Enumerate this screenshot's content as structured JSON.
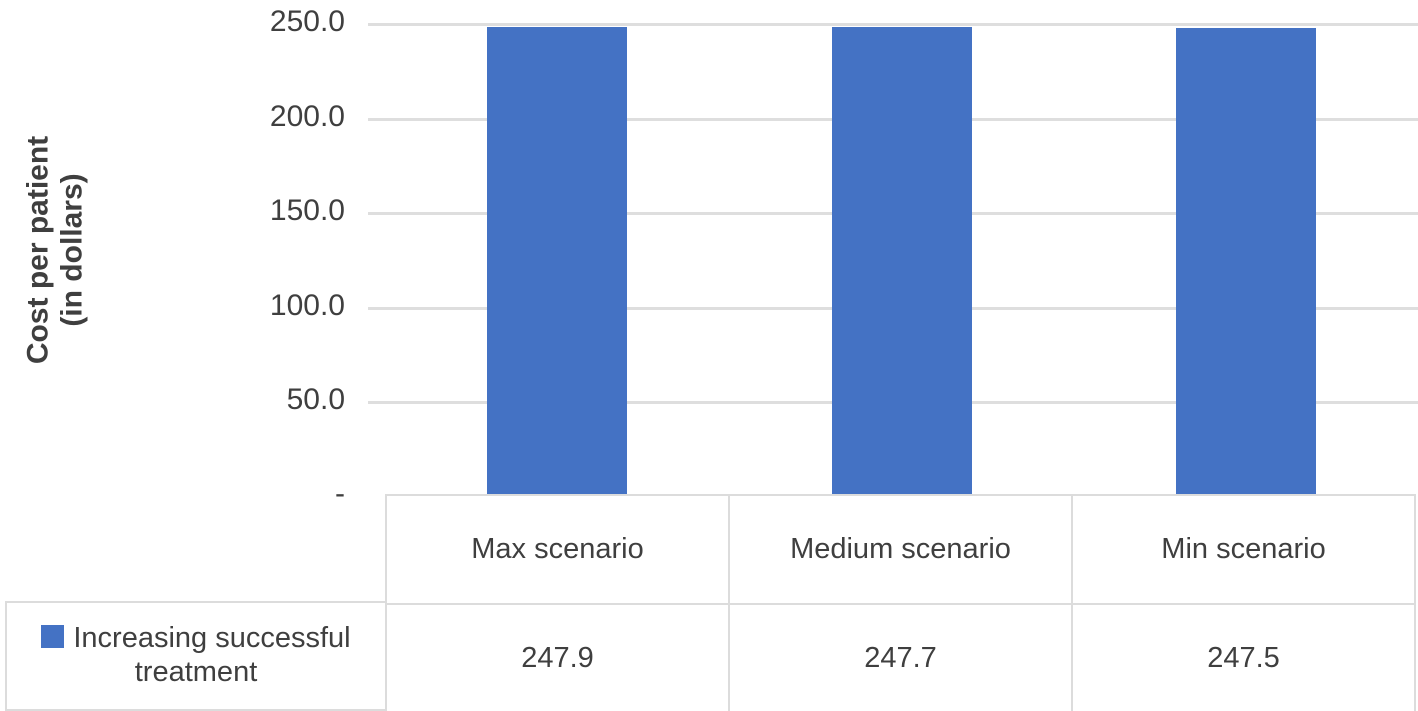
{
  "chart_data": {
    "type": "bar",
    "title": "",
    "xlabel": "",
    "ylabel": "Cost per patient (in dollars)",
    "ylabel_lines": [
      "Cost per patient",
      "(in dollars)"
    ],
    "categories": [
      "Max scenario",
      "Medium scenario",
      "Min scenario"
    ],
    "series": [
      {
        "name": "Increasing successful treatment",
        "values": [
          247.9,
          247.7,
          247.5
        ],
        "value_labels": [
          "247.9",
          "247.7",
          "247.5"
        ],
        "color": "#4472C4"
      }
    ],
    "ylim": [
      0,
      250
    ],
    "y_ticks": [
      0,
      50,
      100,
      150,
      200,
      250
    ],
    "y_tick_labels": [
      "-",
      "50.0",
      "100.0",
      "150.0",
      "200.0",
      "250.0"
    ],
    "grid": true,
    "grid_color": "#DEDEDE",
    "legend_position": "bottom-left",
    "data_table_visible": true,
    "background_color": "#FFFFFF",
    "text_color": "#3F3F3F"
  },
  "axis": {
    "y_title_line1": "Cost per patient",
    "y_title_line2": "(in dollars)",
    "ticks": [
      {
        "label": "250.0",
        "value": 250
      },
      {
        "label": "200.0",
        "value": 200
      },
      {
        "label": "150.0",
        "value": 150
      },
      {
        "label": "100.0",
        "value": 100
      },
      {
        "label": "50.0",
        "value": 50
      },
      {
        "label": "-",
        "value": 0
      }
    ]
  },
  "legend": {
    "series_label": "Increasing successful treatment",
    "swatch_color": "#4472C4"
  },
  "table": {
    "headers": [
      "Max scenario",
      "Medium scenario",
      "Min scenario"
    ],
    "values": [
      "247.9",
      "247.7",
      "247.5"
    ]
  }
}
